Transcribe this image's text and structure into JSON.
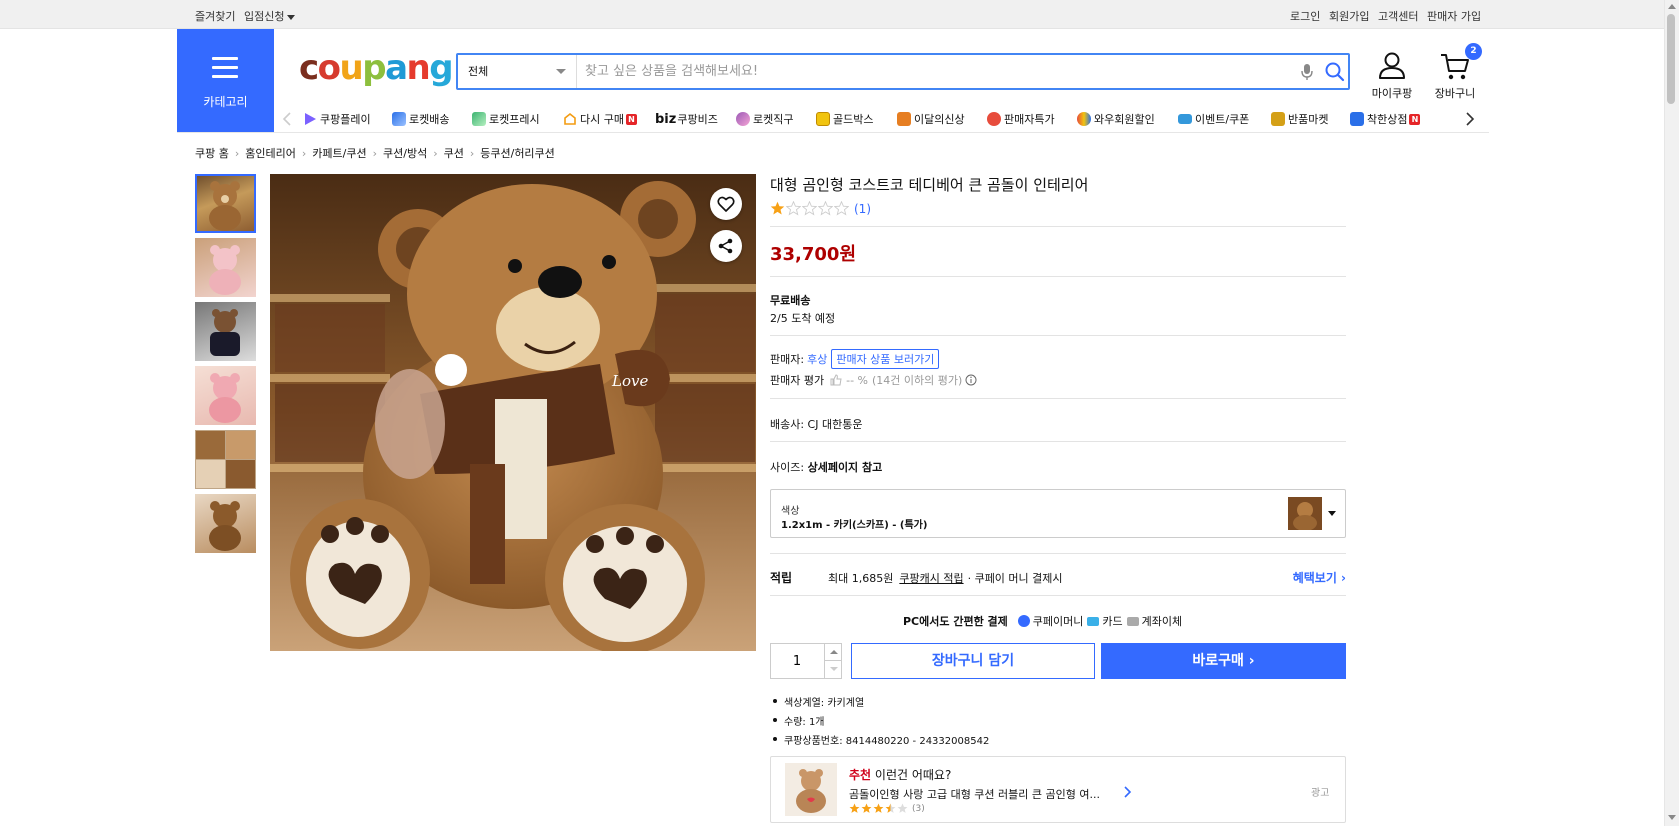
{
  "topbar": {
    "left": [
      "즐겨찾기",
      "입점신청"
    ],
    "right": [
      "로그인",
      "회원가입",
      "고객센터",
      "판매자 가입"
    ]
  },
  "header": {
    "category_label": "카테고리",
    "logo": [
      "c",
      "o",
      "u",
      "p",
      "a",
      "n",
      "g"
    ],
    "logo_colors": [
      "#7b2e1e",
      "#d63b2e",
      "#f1a418",
      "#8dbf3d",
      "#1f9ad6",
      "#e53a2c",
      "#26a8d9"
    ],
    "search": {
      "category": "전체",
      "placeholder": "찾고 싶은 상품을 검색해보세요!",
      "value": ""
    },
    "mycoupang_label": "마이쿠팡",
    "cart_label": "장바구니",
    "cart_count": "2"
  },
  "gnb": [
    {
      "label": "쿠팡플레이",
      "icon": "play-icon",
      "color": "#7b61ff"
    },
    {
      "label": "로켓배송",
      "icon": "rocket-icon",
      "color": "#2a6fe8"
    },
    {
      "label": "로켓프레시",
      "icon": "rocket-fresh-icon",
      "color": "#3cb371"
    },
    {
      "label": "다시 구매",
      "icon": "rebuy-icon",
      "color": "#f39c12",
      "badge": "N"
    },
    {
      "label": "쿠팡비즈",
      "icon": "biz-icon",
      "color": "#111111"
    },
    {
      "label": "로켓직구",
      "icon": "global-icon",
      "color": "#9b59b6"
    },
    {
      "label": "골드박스",
      "icon": "goldbox-icon",
      "color": "#f1c40f"
    },
    {
      "label": "이달의신상",
      "icon": "newitem-icon",
      "color": "#e67e22"
    },
    {
      "label": "판매자특가",
      "icon": "sale-icon",
      "color": "#e74c3c"
    },
    {
      "label": "와우회원할인",
      "icon": "wow-icon",
      "color": "#2a6fe8"
    },
    {
      "label": "이벤트/쿠폰",
      "icon": "coupon-icon",
      "color": "#3498db"
    },
    {
      "label": "반품마켓",
      "icon": "return-market-icon",
      "color": "#d4a017"
    },
    {
      "label": "착한상점",
      "icon": "good-store-icon",
      "color": "#2a6fe8",
      "badge": "N"
    }
  ],
  "gnb_biz_prefix": "biz",
  "breadcrumb": [
    "쿠팡 홈",
    "홈인테리어",
    "카페트/쿠션",
    "쿠션/방석",
    "쿠션",
    "등쿠션/허리쿠션"
  ],
  "product": {
    "title": "대형 곰인형 코스트코 테디베어 큰 곰돌이 인테리어",
    "rating_stars": 1,
    "rating_count": "(1)",
    "price": "33,700원",
    "shipping_title": "무료배송",
    "shipping_date": "2/5 도착 예정",
    "seller_label": "판매자:",
    "seller_name": "후상",
    "seller_button": "판매자 상품 보러가기",
    "seller_rating_label": "판매자 평가",
    "seller_rating_value": "-- %",
    "seller_rating_note": "(14건 이하의 평가)",
    "delivery": "배송사:  CJ 대한통운",
    "size_label": "사이즈:",
    "size_value": "상세페이지 참고",
    "option_label": "색상",
    "option_value": "1.2x1m - 카키(스카프) - (특가)",
    "points_title": "적립",
    "points_prefix": "최대 1,685원",
    "points_link": "쿠팡캐시 적립",
    "points_suffix": "· 쿠페이 머니 결제시",
    "benefit_link": "혜택보기 ›",
    "pay_title": "PC에서도 간편한 결제",
    "pay_methods": [
      "쿠페이머니",
      "카드",
      "계좌이체"
    ],
    "quantity": "1",
    "cart_button": "장바구니 담기",
    "buy_button": "바로구매 ›",
    "attributes": [
      "색상계열: 카키계열",
      "수량: 1개",
      "쿠팡상품번호: 8414480220 - 24332008542"
    ]
  },
  "recommendation": {
    "title_red": "추천",
    "title_rest": " 이런건 어때요?",
    "desc": "곰돌이인형 사랑 고급 대형 쿠션 러블리 큰 곰인형 여...",
    "stars": 3.5,
    "count": "(3)",
    "ad_label": "광고"
  },
  "colors": {
    "accent": "#346aff",
    "price": "#ae0000",
    "star": "#f7a116"
  }
}
